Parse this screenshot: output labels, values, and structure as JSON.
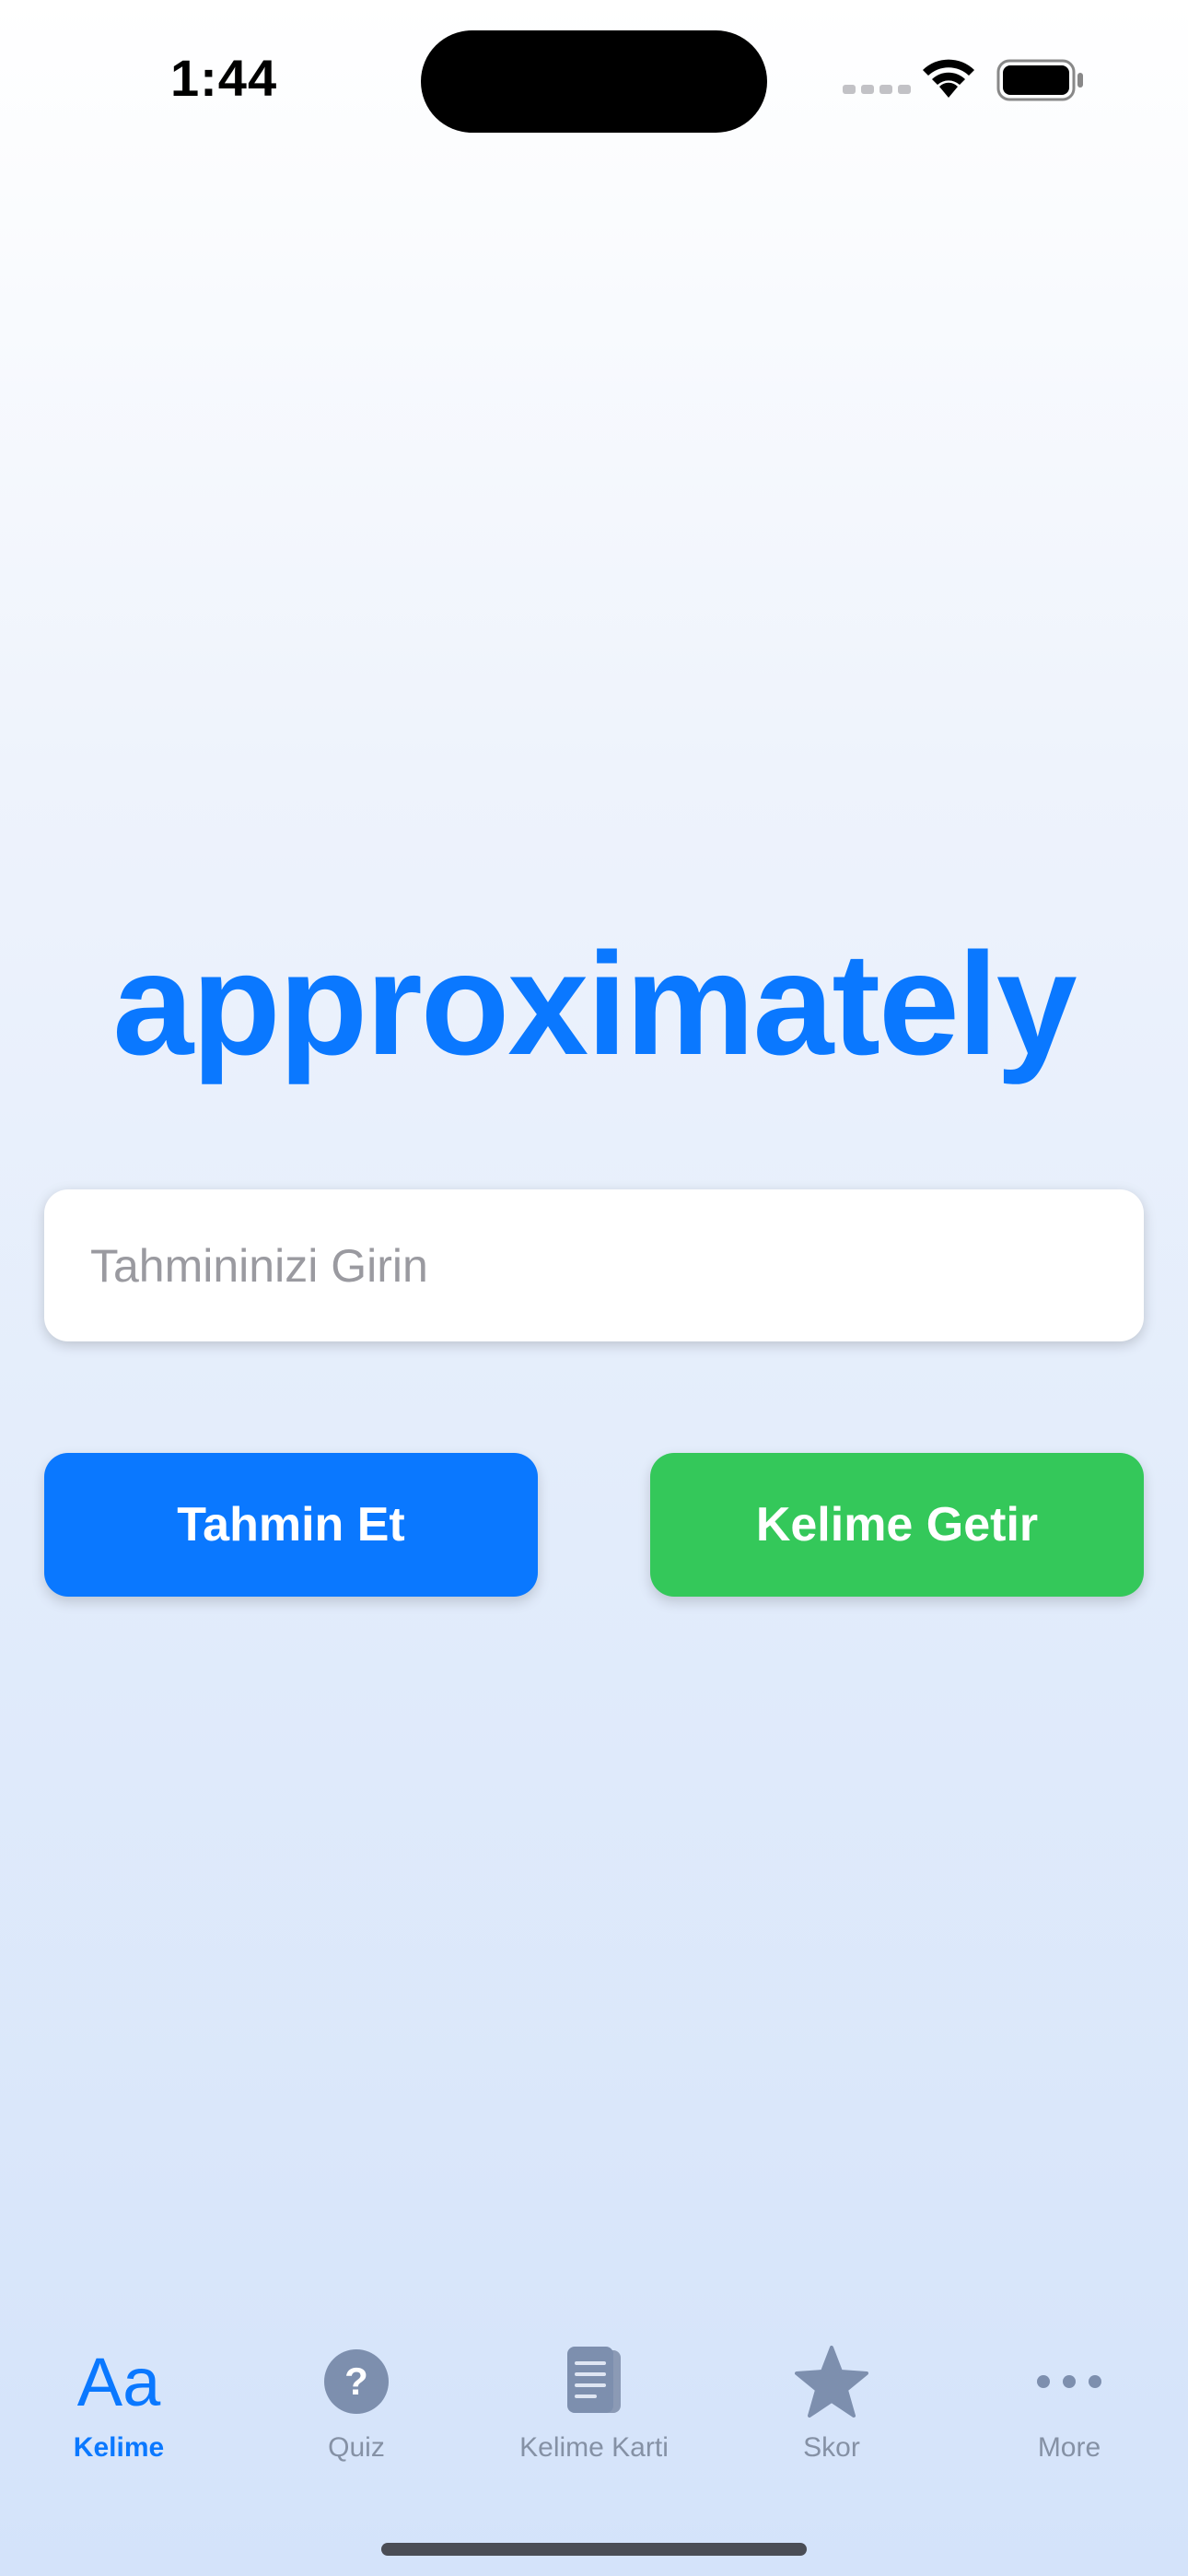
{
  "status_bar": {
    "time": "1:44"
  },
  "main": {
    "word": "approximately",
    "input": {
      "placeholder": "Tahmininizi Girin",
      "value": ""
    },
    "guess_button_label": "Tahmin Et",
    "fetch_button_label": "Kelime Getir"
  },
  "tab_bar": {
    "tabs": [
      {
        "label": "Kelime",
        "icon": "text-aa-icon",
        "active": true
      },
      {
        "label": "Quiz",
        "icon": "question-circle-icon",
        "active": false
      },
      {
        "label": "Kelime Karti",
        "icon": "book-icon",
        "active": false
      },
      {
        "label": "Skor",
        "icon": "star-icon",
        "active": false
      },
      {
        "label": "More",
        "icon": "ellipsis-icon",
        "active": false
      }
    ]
  },
  "colors": {
    "accent": "#0a78ff",
    "success": "#34c85a",
    "tab_inactive": "#8591a5"
  }
}
